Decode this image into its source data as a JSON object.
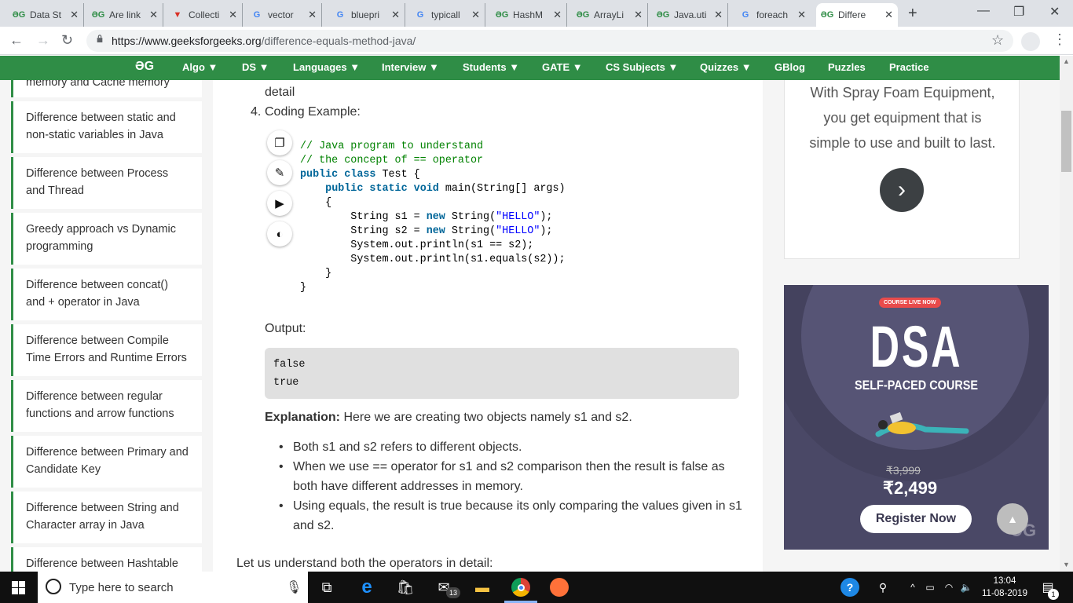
{
  "browser": {
    "tabs": [
      {
        "icon": "gfg-icon",
        "title": "Data St"
      },
      {
        "icon": "gfg-icon",
        "title": "Are link"
      },
      {
        "icon": "vertabelo-icon",
        "title": "Collecti"
      },
      {
        "icon": "google-icon",
        "title": "vector"
      },
      {
        "icon": "google-icon",
        "title": "bluepri"
      },
      {
        "icon": "google-icon",
        "title": "typicall"
      },
      {
        "icon": "gfg-icon",
        "title": "HashM"
      },
      {
        "icon": "gfg-icon",
        "title": "ArrayLi"
      },
      {
        "icon": "gfg-icon",
        "title": "Java.uti"
      },
      {
        "icon": "google-icon",
        "title": "foreach"
      },
      {
        "icon": "gfg-icon",
        "title": "Differe",
        "active": true
      }
    ],
    "new_tab": "+",
    "url_host": "https://www.geeksforgeeks.org",
    "url_path": "/difference-equals-method-java/"
  },
  "nav": {
    "logo": "ƏG",
    "items": [
      "Algo ▼",
      "DS ▼",
      "Languages ▼",
      "Interview ▼",
      "Students ▼",
      "GATE ▼",
      "CS Subjects ▼",
      "Quizzes ▼",
      "GBlog",
      "Puzzles",
      "Practice"
    ]
  },
  "sidebar": {
    "items": [
      "Difference between static and non-static variables in Java",
      "Difference between Process and Thread",
      "Greedy approach vs Dynamic programming",
      "Difference between concat() and + operator in Java",
      "Difference between Compile Time Errors and Runtime Errors",
      "Difference between regular functions and arrow functions",
      "Difference between Primary and Candidate Key",
      "Difference between String and Character array in Java",
      "Difference between Hashtable"
    ],
    "partial_top": "memory and Cache memory"
  },
  "article": {
    "detail_text": "detail",
    "list_number": "4.",
    "coding_example": "Coding Example:",
    "code_lines": [
      "// Java program to understand",
      "// the concept of == operator",
      "public class Test {",
      "    public static void main(String[] args)",
      "    {",
      "        String s1 = new String(\"HELLO\");",
      "        String s2 = new String(\"HELLO\");",
      "        System.out.println(s1 == s2);",
      "        System.out.println(s1.equals(s2));",
      "    }",
      "}"
    ],
    "output_label": "Output:",
    "output_lines": [
      "false",
      "true"
    ],
    "explanation_label": "Explanation:",
    "explanation_text": " Here we are creating two objects namely s1 and s2.",
    "bullets": [
      "Both s1 and s2 refers to different objects.",
      "When we use == operator for s1 and s2 comparison then the result is false as both have different addresses in memory.",
      "Using equals, the result is true because its only comparing the values given in s1 and s2."
    ],
    "next_para": "Let us understand both the operators in detail:"
  },
  "ads": {
    "ad1_text": "With Spray Foam Equipment, you get equipment that is simple to use and built to last.",
    "ad2": {
      "live": "COURSE LIVE NOW",
      "title": "DSA",
      "subtitle": "SELF-PACED COURSE",
      "old_price": "₹3,999",
      "price": "₹2,499",
      "cta": "Register Now",
      "logo": "ƏG"
    }
  },
  "taskbar": {
    "search_placeholder": "Type here to search",
    "time": "13:04",
    "date": "11-08-2019",
    "mail_badge": "13",
    "notif_badge": "1"
  },
  "colors": {
    "brand_green": "#2f8d46",
    "ad_bg": "#4a4866"
  }
}
